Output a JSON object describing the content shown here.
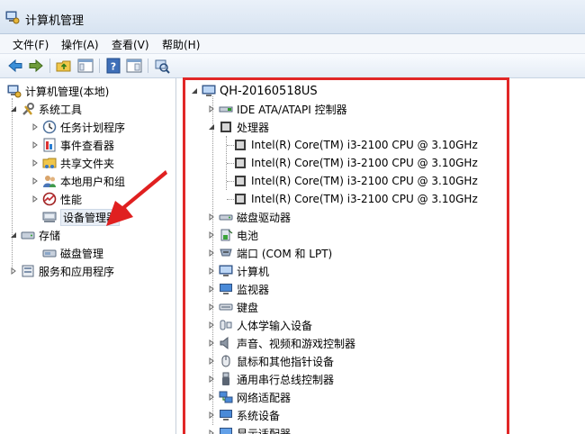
{
  "window": {
    "title": "计算机管理"
  },
  "menu": {
    "file": "文件(F)",
    "action": "操作(A)",
    "view": "查看(V)",
    "help": "帮助(H)"
  },
  "left_tree": {
    "root": "计算机管理(本地)",
    "system_tools": "系统工具",
    "task_scheduler": "任务计划程序",
    "event_viewer": "事件查看器",
    "shared_folders": "共享文件夹",
    "local_users": "本地用户和组",
    "performance": "性能",
    "device_manager": "设备管理器",
    "storage": "存储",
    "disk_management": "磁盘管理",
    "services_apps": "服务和应用程序"
  },
  "device_tree": {
    "computer": "QH-20160518US",
    "categories": [
      "IDE ATA/ATAPI 控制器",
      "处理器",
      "磁盘驱动器",
      "电池",
      "端口 (COM 和 LPT)",
      "计算机",
      "监视器",
      "键盘",
      "人体学输入设备",
      "声音、视频和游戏控制器",
      "鼠标和其他指针设备",
      "通用串行总线控制器",
      "网络适配器",
      "系统设备",
      "显示适配器"
    ],
    "processors": [
      "Intel(R) Core(TM) i3-2100 CPU @ 3.10GHz",
      "Intel(R) Core(TM) i3-2100 CPU @ 3.10GHz",
      "Intel(R) Core(TM) i3-2100 CPU @ 3.10GHz",
      "Intel(R) Core(TM) i3-2100 CPU @ 3.10GHz"
    ]
  },
  "colors": {
    "highlight_box": "#e12727",
    "arrow": "#e02020"
  }
}
